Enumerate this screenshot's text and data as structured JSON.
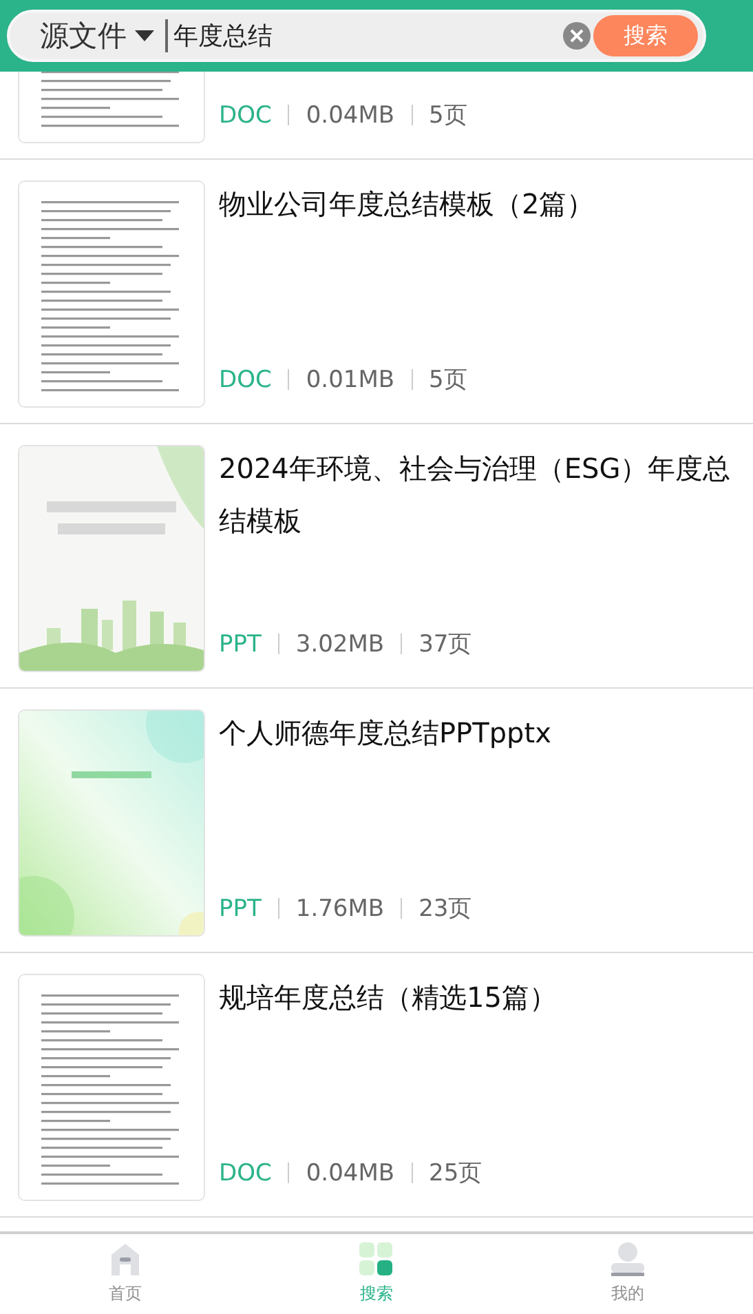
{
  "search": {
    "scope": "源文件",
    "value": "年度总结",
    "button": "搜索"
  },
  "results": [
    {
      "format": "DOC",
      "size": "0.04MB",
      "pages": "5页"
    },
    {
      "title": "物业公司年度总结模板（2篇）",
      "format": "DOC",
      "size": "0.01MB",
      "pages": "5页"
    },
    {
      "title": "2024年环境、社会与治理（ESG）年度总结模板",
      "format": "PPT",
      "size": "3.02MB",
      "pages": "37页"
    },
    {
      "title": "个人师德年度总结PPTpptx",
      "format": "PPT",
      "size": "1.76MB",
      "pages": "23页"
    },
    {
      "title": "规培年度总结（精选15篇）",
      "format": "DOC",
      "size": "0.04MB",
      "pages": "25页"
    }
  ],
  "nav": [
    {
      "kind": "home",
      "label": "首页",
      "selected": false
    },
    {
      "kind": "grid",
      "label": "搜索",
      "selected": true
    },
    {
      "kind": "person",
      "label": "我的",
      "selected": false
    }
  ]
}
